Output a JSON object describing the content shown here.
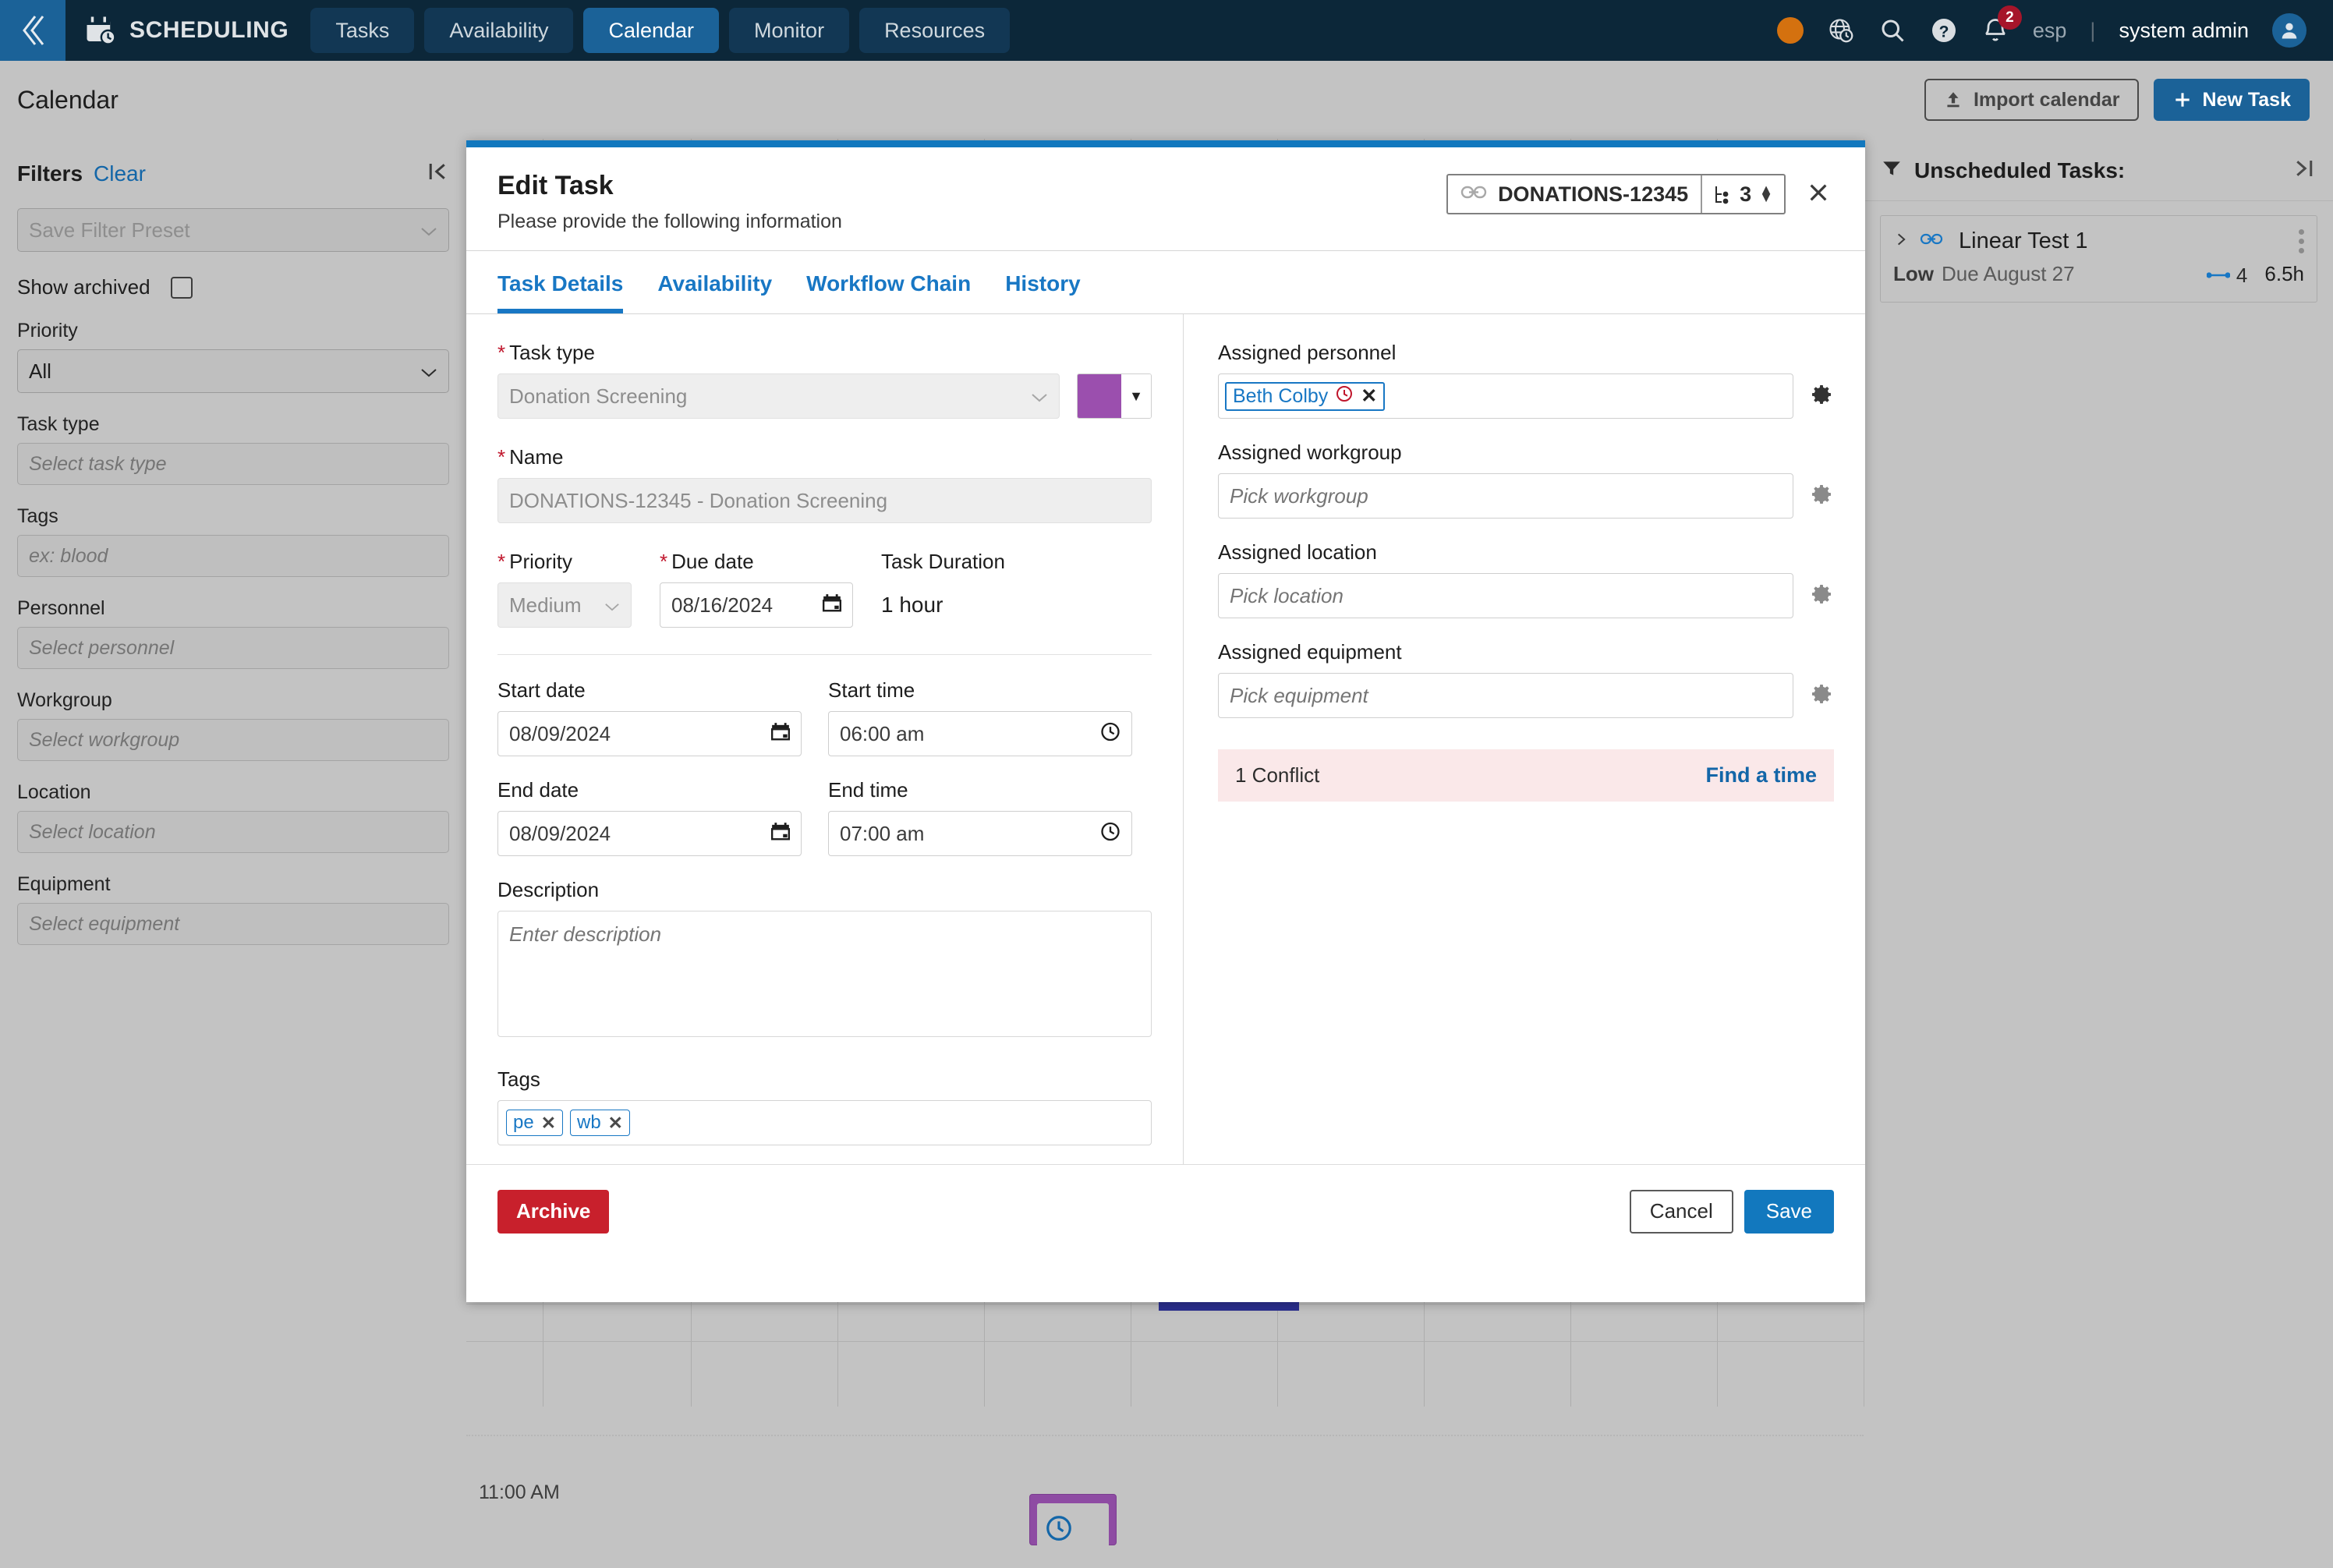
{
  "topnav": {
    "back_icon": "chevron-double-left-icon",
    "brand_icon": "calendar-clock-icon",
    "brand": "SCHEDULING",
    "tabs": [
      {
        "label": "Tasks",
        "active": false
      },
      {
        "label": "Availability",
        "active": false
      },
      {
        "label": "Calendar",
        "active": true
      },
      {
        "label": "Monitor",
        "active": false
      },
      {
        "label": "Resources",
        "active": false
      }
    ],
    "status_dot_color": "#d4710f",
    "icons": [
      "globe-clock-icon",
      "search-icon",
      "help-icon",
      "notifications-bell-icon"
    ],
    "notification_count": "2",
    "language": "esp",
    "separator": "|",
    "user": "system admin",
    "avatar_icon": "user-avatar-icon"
  },
  "pageheader": {
    "title": "Calendar",
    "import_label": "Import calendar",
    "import_icon": "upload-icon",
    "new_task_label": "New Task",
    "new_task_icon": "plus-icon"
  },
  "sidebar": {
    "title": "Filters",
    "clear": "Clear",
    "collapse_icon": "collapse-left-icon",
    "preset": {
      "placeholder": "Save Filter Preset"
    },
    "show_archived": {
      "label": "Show archived",
      "checked": false
    },
    "fields": [
      {
        "label": "Priority",
        "value": "All",
        "type": "select"
      },
      {
        "label": "Task type",
        "placeholder": "Select task type",
        "type": "input"
      },
      {
        "label": "Tags",
        "placeholder": "ex: blood",
        "type": "input"
      },
      {
        "label": "Personnel",
        "placeholder": "Select personnel",
        "type": "input"
      },
      {
        "label": "Workgroup",
        "placeholder": "Select workgroup",
        "type": "input"
      },
      {
        "label": "Location",
        "placeholder": "Select location",
        "type": "input"
      },
      {
        "label": "Equipment",
        "placeholder": "Select equipment",
        "type": "input"
      }
    ]
  },
  "calendar": {
    "time_label": "11:00 AM",
    "event_color": "#8e4ba3",
    "event_icon": "clock-icon",
    "selected_bar_color": "#2b2f8f"
  },
  "unscheduled": {
    "filter_icon": "funnel-icon",
    "title": "Unscheduled Tasks:",
    "expand_icon": "expand-right-icon",
    "tasks": [
      {
        "expand_icon": "chevron-right-icon",
        "link_icon": "link-icon",
        "name": "Linear Test 1",
        "priority": "Low",
        "due": "Due August 27",
        "chain_icon": "chain-length-icon",
        "chain_count": "4",
        "duration": "6.5h",
        "menu_icon": "kebab-menu-icon"
      }
    ]
  },
  "modal": {
    "accent_color": "#1278be",
    "title": "Edit Task",
    "subtitle": "Please provide the following information",
    "chip": {
      "link_icon": "link-icon",
      "id": "DONATIONS-12345",
      "steps_icon": "workflow-steps-icon",
      "steps": "3",
      "stepper_icon": "stepper-updown-icon"
    },
    "close_icon": "close-icon",
    "tabs": [
      {
        "label": "Task Details",
        "active": true
      },
      {
        "label": "Availability",
        "active": false
      },
      {
        "label": "Workflow Chain",
        "active": false
      },
      {
        "label": "History",
        "active": false
      }
    ],
    "left": {
      "task_type": {
        "label": "Task type",
        "required": true,
        "value": "Donation Screening",
        "chevron_icon": "chevron-down-icon"
      },
      "color": {
        "swatch": "#9b4fae",
        "arrow_icon": "caret-down-icon"
      },
      "name": {
        "label": "Name",
        "required": true,
        "value": "DONATIONS-12345 - Donation Screening"
      },
      "priority": {
        "label": "Priority",
        "required": true,
        "value": "Medium",
        "chevron_icon": "chevron-down-icon"
      },
      "due_date": {
        "label": "Due date",
        "required": true,
        "value": "08/16/2024",
        "icon": "calendar-icon"
      },
      "duration": {
        "label": "Task Duration",
        "value": "1 hour"
      },
      "start_date": {
        "label": "Start date",
        "value": "08/09/2024",
        "icon": "calendar-icon"
      },
      "start_time": {
        "label": "Start time",
        "value": "06:00 am",
        "icon": "clock-icon"
      },
      "end_date": {
        "label": "End date",
        "value": "08/09/2024",
        "icon": "calendar-icon"
      },
      "end_time": {
        "label": "End time",
        "value": "07:00 am",
        "icon": "clock-icon"
      },
      "description": {
        "label": "Description",
        "placeholder": "Enter description",
        "value": ""
      },
      "tags": {
        "label": "Tags",
        "items": [
          "pe",
          "wb"
        ],
        "remove_icon": "close-icon"
      }
    },
    "right": {
      "personnel": {
        "label": "Assigned personnel",
        "chip": "Beth Colby",
        "chip_warn_icon": "clock-warning-icon",
        "remove_icon": "close-icon",
        "gear_icon": "gear-icon"
      },
      "workgroup": {
        "label": "Assigned workgroup",
        "placeholder": "Pick workgroup",
        "gear_icon": "gear-icon"
      },
      "location": {
        "label": "Assigned location",
        "placeholder": "Pick location",
        "gear_icon": "gear-icon"
      },
      "equipment": {
        "label": "Assigned equipment",
        "placeholder": "Pick equipment",
        "gear_icon": "gear-icon"
      },
      "conflict": {
        "text": "1 Conflict",
        "link": "Find a time",
        "bg_color": "#fae8e9"
      }
    },
    "footer": {
      "archive": "Archive",
      "cancel": "Cancel",
      "save": "Save",
      "archive_color": "#c8202c",
      "save_color": "#1278be"
    }
  }
}
